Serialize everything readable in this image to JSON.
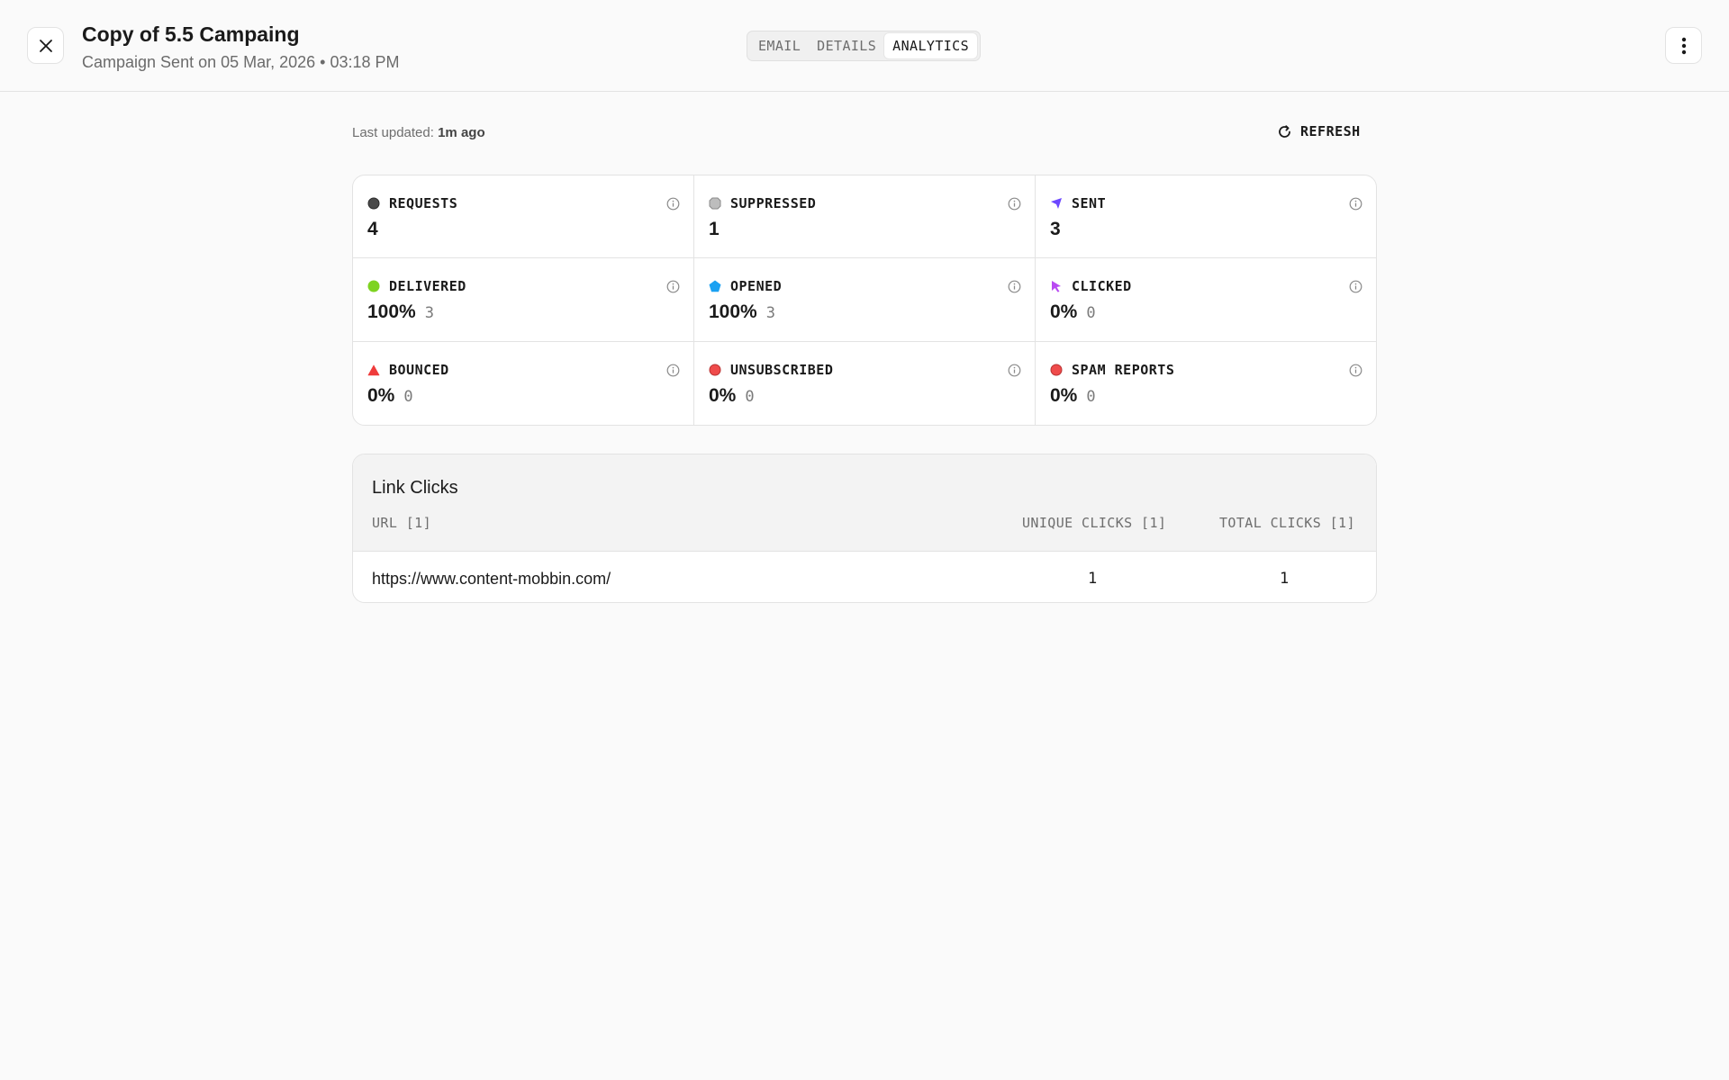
{
  "header": {
    "title": "Copy of 5.5 Campaing",
    "subtitle": "Campaign Sent on 05 Mar, 2026 • 03:18 PM",
    "tabs": [
      {
        "label": "EMAIL",
        "active": false
      },
      {
        "label": "DETAILS",
        "active": false
      },
      {
        "label": "ANALYTICS",
        "active": true
      }
    ],
    "close_icon": "close-icon",
    "more_icon": "more-vertical-icon"
  },
  "status": {
    "updated_label": "Last updated:",
    "updated_value": "1m ago",
    "refresh_label": "REFRESH"
  },
  "stats": [
    {
      "label": "REQUESTS",
      "value": "4",
      "sub": "",
      "icon": "circle-icon",
      "color": "#4a4a4a"
    },
    {
      "label": "SUPPRESSED",
      "value": "1",
      "sub": "",
      "icon": "octagon-icon",
      "color": "#bdbdbd"
    },
    {
      "label": "SENT",
      "value": "3",
      "sub": "",
      "icon": "send-icon",
      "color": "#6c47ff"
    },
    {
      "label": "DELIVERED",
      "value": "100%",
      "sub": "3",
      "icon": "circle-icon",
      "color": "#7ed321"
    },
    {
      "label": "OPENED",
      "value": "100%",
      "sub": "3",
      "icon": "pentagon-icon",
      "color": "#1ba1f2"
    },
    {
      "label": "CLICKED",
      "value": "0%",
      "sub": "0",
      "icon": "cursor-icon",
      "color": "#b84af2"
    },
    {
      "label": "BOUNCED",
      "value": "0%",
      "sub": "0",
      "icon": "triangle-icon",
      "color": "#ef3b3b"
    },
    {
      "label": "UNSUBSCRIBED",
      "value": "0%",
      "sub": "0",
      "icon": "circle-icon",
      "color": "#ef4b4b"
    },
    {
      "label": "SPAM REPORTS",
      "value": "0%",
      "sub": "0",
      "icon": "circle-icon",
      "color": "#ef4b4b"
    }
  ],
  "link_clicks": {
    "title": "Link Clicks",
    "columns": {
      "url": "URL [1]",
      "unique": "UNIQUE CLICKS [1]",
      "total": "TOTAL CLICKS [1]"
    },
    "rows": [
      {
        "url": "https://www.content-mobbin.com/",
        "unique": "1",
        "total": "1"
      }
    ]
  }
}
